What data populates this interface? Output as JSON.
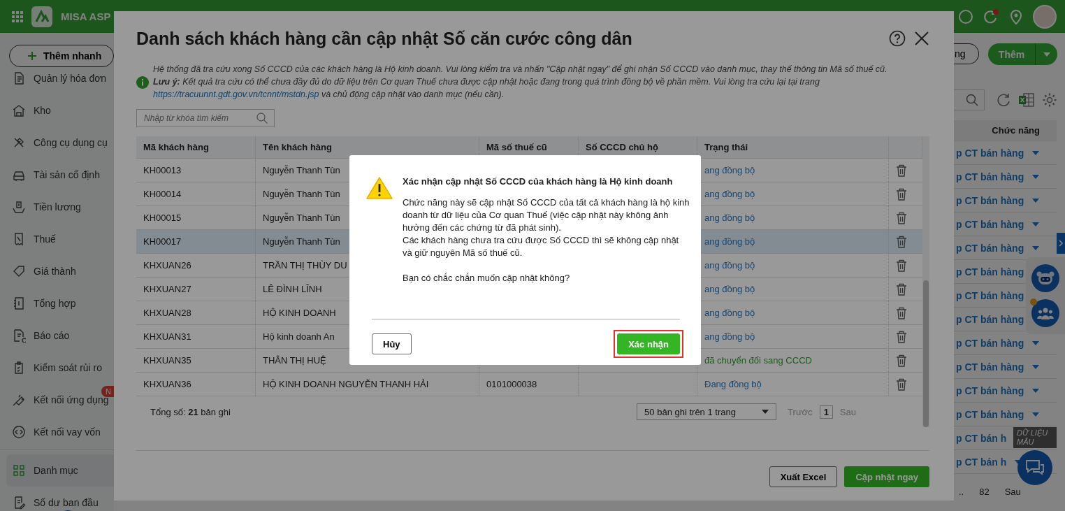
{
  "topbar": {
    "app_name": "MISA ASP"
  },
  "sidebar": {
    "quick_add": "Thêm nhanh",
    "items": [
      {
        "label": "Quản lý hóa đơn",
        "selected": false
      },
      {
        "label": "Kho",
        "selected": false
      },
      {
        "label": "Công cụ dụng cụ",
        "selected": false
      },
      {
        "label": "Tài sản cố định",
        "selected": false
      },
      {
        "label": "Tiền lương",
        "selected": false
      },
      {
        "label": "Thuế",
        "selected": false
      },
      {
        "label": "Giá thành",
        "selected": false
      },
      {
        "label": "Tổng hợp",
        "selected": false
      },
      {
        "label": "Báo cáo",
        "selected": false
      },
      {
        "label": "Kiểm soát rủi ro",
        "selected": false
      },
      {
        "label": "Kết nối ứng dụng",
        "selected": false,
        "badge": "N"
      },
      {
        "label": "Kết nối vay vốn",
        "selected": false
      },
      {
        "label": "Danh mục",
        "selected": true
      },
      {
        "label": "Số dư ban đầu",
        "selected": false
      }
    ]
  },
  "background_page": {
    "cut_button": "ng",
    "add_button": "Thêm",
    "column_header": "Chức năng",
    "rows": [
      "p CT bán hàng",
      "p CT bán hàng",
      "p CT bán hàng",
      "p CT bán hàng",
      "p CT bán hàng",
      "p CT bán hàng",
      "p CT bán hàng",
      "p CT bán hàng",
      "p CT bán hàng",
      "p CT bán hàng",
      "p CT bán hàng",
      "p CT bán hàng",
      "p CT bán h",
      "p CT bán h"
    ],
    "pagination": {
      "ellipsis": "..",
      "last_page": "82",
      "next": "Sau"
    },
    "sample_data_stamp": "DỮ LIỆU MẪU"
  },
  "modal": {
    "title": "Danh sách khách hàng cần cập nhật Số căn cước công dân",
    "info": "Hệ thống đã tra cứu xong Số CCCD của các khách hàng là Hộ kinh doanh. Vui lòng kiểm tra và nhấn \"Cập nhật ngay\" để ghi nhận Số CCCD vào danh mục, thay thế thông tin Mã số thuế cũ.",
    "note": "**Lưu ý:** Kết quả tra cứu có thể chưa đầy đủ do dữ liệu trên Cơ quan Thuế chưa được cập nhật hoặc đang trong quá trình đồng bộ về phần mềm. Vui lòng tra cứu lại tại trang",
    "link": "https://tracuunnt.gdt.gov.vn/tcnnt/mstdn.jsp",
    "note_end": "và chủ động cập nhật vào danh mục (nếu cần).",
    "search": {
      "placeholder": "Nhập từ khóa tìm kiếm"
    },
    "table": {
      "columns": [
        "Mã khách hàng",
        "Tên khách hàng",
        "Mã số thuế cũ",
        "Số CCCD chủ hộ",
        "Trạng thái"
      ],
      "rows": [
        {
          "code": "KH00013",
          "name": "Nguyễn Thanh Tùn",
          "status": "ang đồng bộ",
          "kind": "syncing",
          "selected": false
        },
        {
          "code": "KH00014",
          "name": "Nguyễn Thanh Tùn",
          "status": "ang đồng bộ",
          "kind": "syncing",
          "selected": false
        },
        {
          "code": "KH00015",
          "name": "Nguyễn Thanh Tùn",
          "status": "ang đồng bộ",
          "kind": "syncing",
          "selected": false
        },
        {
          "code": "KH00017",
          "name": "Nguyễn Thanh Tùn",
          "status": "ang đồng bộ",
          "kind": "syncing",
          "selected": true
        },
        {
          "code": "KHXUAN26",
          "name": "TRẦN THỊ THÙY DU",
          "status": "ang đồng bộ",
          "kind": "syncing",
          "selected": false
        },
        {
          "code": "KHXUAN27",
          "name": "LÊ ĐÌNH LĨNH",
          "status": "ang đồng bộ",
          "kind": "syncing",
          "selected": false
        },
        {
          "code": "KHXUAN28",
          "name": "HỘ KINH DOANH",
          "status": "ang đồng bộ",
          "kind": "syncing",
          "selected": false
        },
        {
          "code": "KHXUAN31",
          "name": "Hộ kinh doanh An",
          "status": "ang đồng bộ",
          "kind": "syncing",
          "selected": false
        },
        {
          "code": "KHXUAN35",
          "name": "THÂN THỊ HUỆ",
          "status": "đã chuyển đổi sang CCCD",
          "kind": "converted",
          "selected": false
        },
        {
          "code": "KHXUAN36",
          "name": "HỘ KINH DOANH NGUYỄN THANH HẢI",
          "tax_code": "0101000038",
          "status": "Đang đồng bộ",
          "kind": "syncing",
          "selected": false
        }
      ]
    },
    "total": "Tổng số: **21** bản ghi",
    "page_size": "50 bản ghi trên 1 trang",
    "pager": {
      "prev": "Trước",
      "page": "1",
      "next": "Sau"
    },
    "buttons": {
      "export": "Xuất Excel",
      "update": "Cập nhật ngay"
    }
  },
  "dialog": {
    "title": "Xác nhận cập nhật Số CCCD của khách hàng là Hộ kinh doanh",
    "paragraphs": [
      "Chức năng này sẽ cập nhật Số CCCD của tất cả khách hàng là hộ kinh doanh từ dữ liệu của Cơ quan Thuế (việc cập nhật này không ảnh hưởng đến các chứng từ đã phát sinh).",
      "Các khách hàng chưa tra cứu được Số CCCD thì sẽ không cập nhật và giữ nguyên Mã số thuế cũ.",
      "Bạn có chắc chắn muốn cập nhật không?"
    ],
    "cancel": "Hủy",
    "confirm": {
      "label": "Xác nhận",
      "highlighted": true
    }
  }
}
